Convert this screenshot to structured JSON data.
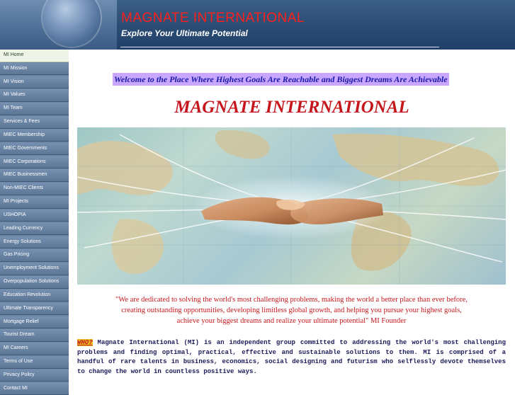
{
  "header": {
    "title": "MAGNATE INTERNATIONAL",
    "tagline": "Explore Your Ultimate Potential"
  },
  "sidebar": {
    "items": [
      {
        "label": "MI Home",
        "active": true
      },
      {
        "label": "MI Mission"
      },
      {
        "label": "MI Vision"
      },
      {
        "label": "MI Values"
      },
      {
        "label": "MI Team"
      },
      {
        "label": "Services & Fees"
      },
      {
        "label": "MIEC Membership"
      },
      {
        "label": "MIEC Governments"
      },
      {
        "label": "MIEC Corporations"
      },
      {
        "label": "MIEC Businessmen"
      },
      {
        "label": "Non-MIEC Clients"
      },
      {
        "label": "MI Projects"
      },
      {
        "label": "USHOPIA"
      },
      {
        "label": "Leading Currency"
      },
      {
        "label": "Energy Solutions"
      },
      {
        "label": "Gas Pricing"
      },
      {
        "label": "Unemployment Solutions"
      },
      {
        "label": "Overpopulation Solutions"
      },
      {
        "label": "Education Revolution"
      },
      {
        "label": "Ultimate Transparency"
      },
      {
        "label": "Mortgage Relief"
      },
      {
        "label": "Tourist Dream"
      },
      {
        "label": "MI Careers"
      },
      {
        "label": "Terms of Use"
      },
      {
        "label": "Privacy Policy"
      },
      {
        "label": "Contact MI"
      }
    ]
  },
  "main": {
    "welcome": "Welcome to the Place Where Highest Goals Are Reachable and Biggest Dreams Are Achievable",
    "title": "MAGNATE  INTERNATIONAL",
    "quote_lines": [
      "\"We are dedicated to solving the world's most challenging problems, making the world a better place than ever before,",
      "creating outstanding opportunities, developing limitless global growth, and helping you pursue your highest goals,",
      "achieve your biggest dreams and realize your ultimate potential\" MI Founder"
    ],
    "who_label": "WHO?",
    "who_text": " Magnate International (MI) is an independent group committed to addressing the world's most challenging problems and finding optimal, practical, effective and sustainable solutions to them. MI is comprised of a handful of rare talents in business, economics, social designing and futurism who selflessly devote themselves to change the world in countless positive ways."
  },
  "colors": {
    "header_bg": "#2b4c72",
    "sidebar_bg": "#6d86a3",
    "active_item_bg": "#eef5e6",
    "title_red": "#c4161c",
    "welcome_highlight": "#c9a6ff",
    "who_highlight": "#f0c020"
  }
}
